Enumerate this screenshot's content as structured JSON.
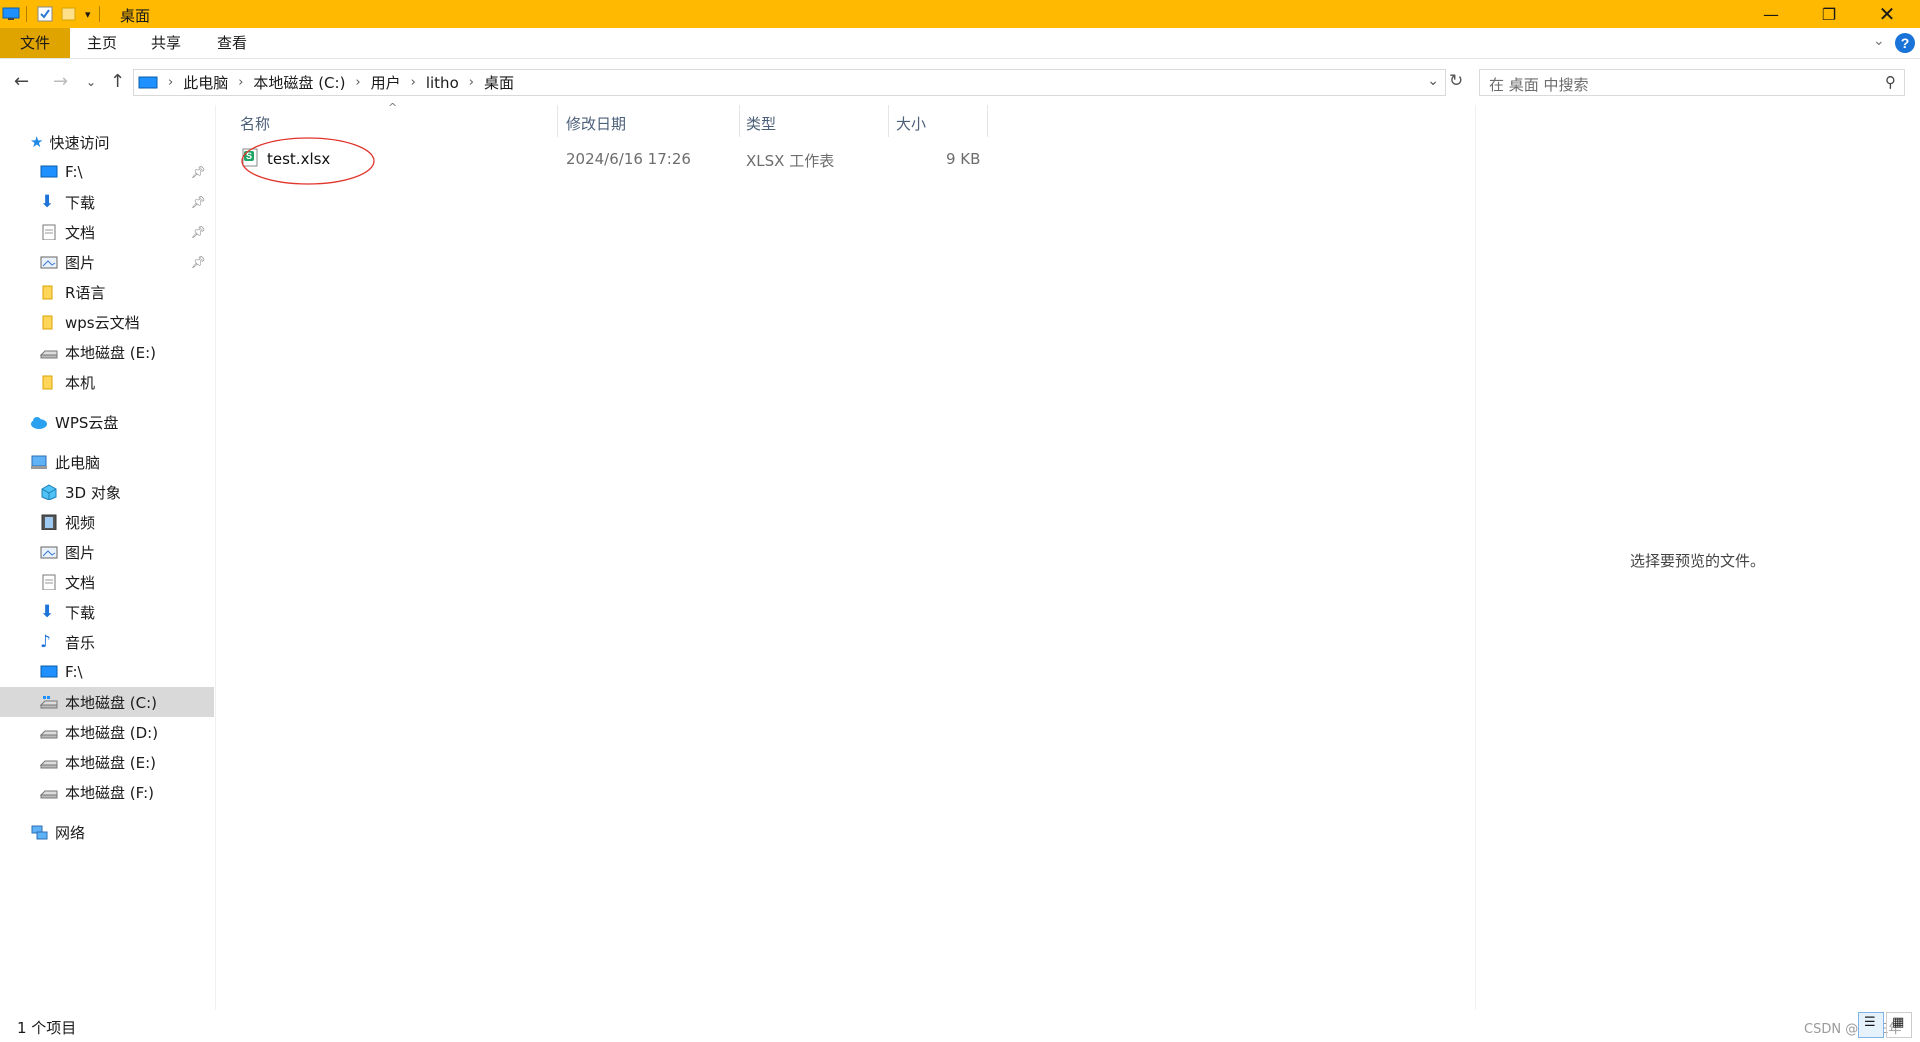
{
  "window": {
    "title": "桌面"
  },
  "ribbon": {
    "tabs": [
      "文件",
      "主页",
      "共享",
      "查看"
    ]
  },
  "address": {
    "crumbs": [
      "此电脑",
      "本地磁盘 (C:)",
      "用户",
      "litho",
      "桌面"
    ]
  },
  "search": {
    "placeholder": "在 桌面 中搜索"
  },
  "sidebar": {
    "quick_access": "快速访问",
    "quick_items": [
      "F:\\",
      "下载",
      "文档",
      "图片",
      "R语言",
      "wps云文档",
      "本地磁盘 (E:)",
      "本机"
    ],
    "wps_cloud": "WPS云盘",
    "this_pc": "此电脑",
    "pc_items": [
      "3D 对象",
      "视频",
      "图片",
      "文档",
      "下载",
      "音乐",
      "F:\\",
      "本地磁盘 (C:)",
      "本地磁盘 (D:)",
      "本地磁盘 (E:)",
      "本地磁盘 (F:)"
    ],
    "network": "网络"
  },
  "columns": {
    "name": "名称",
    "modified": "修改日期",
    "type": "类型",
    "size": "大小"
  },
  "files": [
    {
      "name": "test.xlsx",
      "modified": "2024/6/16 17:26",
      "type": "XLSX 工作表",
      "size": "9 KB"
    }
  ],
  "preview": {
    "empty_text": "选择要预览的文件。"
  },
  "status": {
    "count": "1 个项目"
  },
  "watermark": "CSDN @CE三年",
  "colors": {
    "titlebar": "#ffb900",
    "file_tab": "#e0a400",
    "annotation": "#e0342c"
  }
}
